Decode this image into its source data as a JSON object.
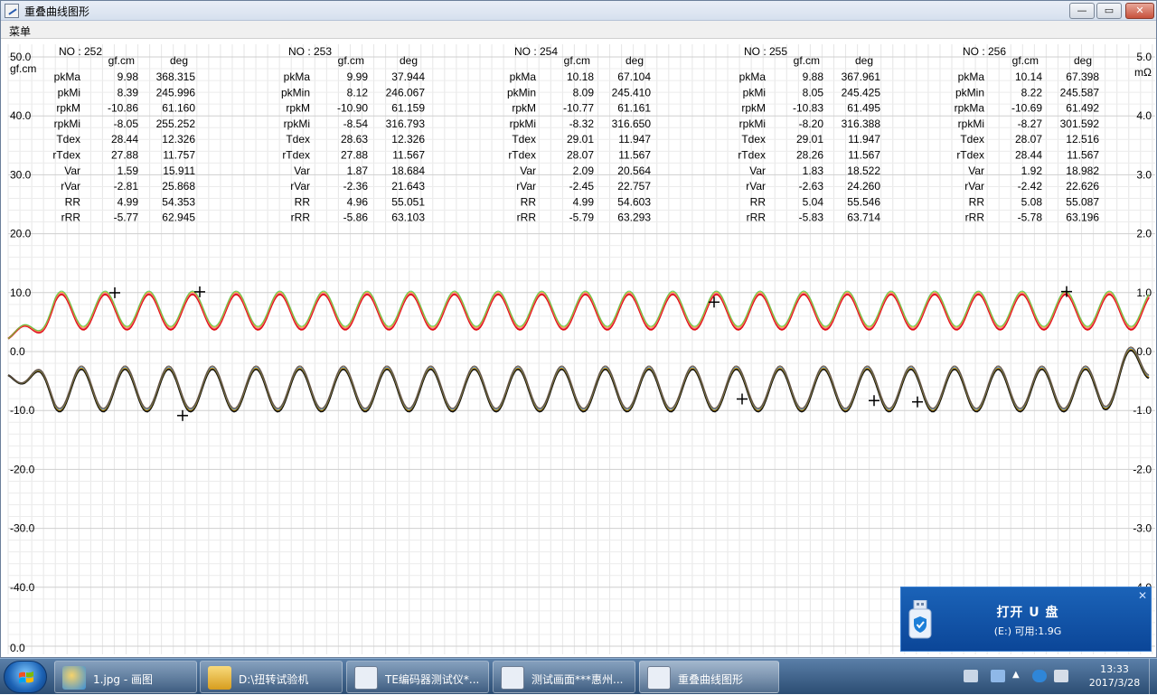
{
  "window": {
    "title": "重叠曲线图形",
    "menu": "菜单",
    "buttons": {
      "minimize": "—",
      "maximize": "▭",
      "close": "✕"
    }
  },
  "chart_data": {
    "type": "line",
    "title": "",
    "left_axis": {
      "unit": "gf.cm",
      "ticks": [
        "50.0",
        "40.0",
        "30.0",
        "20.0",
        "10.0",
        "0.0",
        "-10.0",
        "-20.0",
        "-30.0",
        "-40.0",
        "0.0"
      ],
      "ylim": [
        -50,
        50
      ]
    },
    "right_axis": {
      "unit": "mΩ",
      "ticks": [
        "5.0",
        "4.0",
        "3.0",
        "2.0",
        "1.0",
        "0.0",
        "-1.0",
        "-2.0",
        "-3.0",
        "-4.0"
      ],
      "ylim": [
        -5,
        5
      ]
    },
    "grid": true,
    "series": [
      {
        "color": "#e01010",
        "baseline": 7.0,
        "amplitude": 3.0,
        "period_deg": 15.9
      },
      {
        "color": "#111111",
        "baseline": -6.3,
        "amplitude": 3.6,
        "period_deg": 15.9
      }
    ],
    "measurements": [
      {
        "no": "NO : 252",
        "row_labels": [
          "pkMa",
          "pkMi",
          "rpkM",
          "rpkMi",
          "Tdex",
          "rTdex",
          "Var",
          "rVar",
          "RR",
          "rRR"
        ],
        "gfcm": [
          "9.98",
          "8.39",
          "-10.86",
          "-8.05",
          "28.44",
          "27.88",
          "1.59",
          "-2.81",
          "4.99",
          "-5.77"
        ],
        "deg": [
          "368.315",
          "245.996",
          "61.160",
          "255.252",
          "12.326",
          "11.757",
          "15.911",
          "25.868",
          "54.353",
          "62.945"
        ]
      },
      {
        "no": "NO : 253",
        "row_labels": [
          "pkMa",
          "pkMin",
          "rpkM",
          "rpkMi",
          "Tdex",
          "rTdex",
          "Var",
          "rVar",
          "RR",
          "rRR"
        ],
        "gfcm": [
          "9.99",
          "8.12",
          "-10.90",
          "-8.54",
          "28.63",
          "27.88",
          "1.87",
          "-2.36",
          "4.96",
          "-5.86"
        ],
        "deg": [
          "37.944",
          "246.067",
          "61.159",
          "316.793",
          "12.326",
          "11.567",
          "18.684",
          "21.643",
          "55.051",
          "63.103"
        ]
      },
      {
        "no": "NO : 254",
        "row_labels": [
          "pkMa",
          "pkMin",
          "rpkM",
          "rpkMi",
          "Tdex",
          "rTdex",
          "Var",
          "rVar",
          "RR",
          "rRR"
        ],
        "gfcm": [
          "10.18",
          "8.09",
          "-10.77",
          "-8.32",
          "29.01",
          "28.07",
          "2.09",
          "-2.45",
          "4.99",
          "-5.79"
        ],
        "deg": [
          "67.104",
          "245.410",
          "61.161",
          "316.650",
          "11.947",
          "11.567",
          "20.564",
          "22.757",
          "54.603",
          "63.293"
        ]
      },
      {
        "no": "NO : 255",
        "row_labels": [
          "pkMa",
          "pkMi",
          "rpkM",
          "rpkMi",
          "Tdex",
          "rTdex",
          "Var",
          "rVar",
          "RR",
          "rRR"
        ],
        "gfcm": [
          "9.88",
          "8.05",
          "-10.83",
          "-8.20",
          "29.01",
          "28.26",
          "1.83",
          "-2.63",
          "5.04",
          "-5.83"
        ],
        "deg": [
          "367.961",
          "245.425",
          "61.495",
          "316.388",
          "11.947",
          "11.567",
          "18.522",
          "24.260",
          "55.546",
          "63.714"
        ]
      },
      {
        "no": "NO : 256",
        "row_labels": [
          "pkMa",
          "pkMin",
          "rpkMa",
          "rpkMi",
          "Tdex",
          "rTdex",
          "Var",
          "rVar",
          "RR",
          "rRR"
        ],
        "gfcm": [
          "10.14",
          "8.22",
          "-10.69",
          "-8.27",
          "28.07",
          "28.44",
          "1.92",
          "-2.42",
          "5.08",
          "-5.78"
        ],
        "deg": [
          "67.398",
          "245.587",
          "61.492",
          "301.592",
          "12.516",
          "11.567",
          "18.982",
          "22.626",
          "55.087",
          "63.196"
        ]
      }
    ],
    "col_headers": [
      "gf.cm",
      "deg"
    ]
  },
  "notification": {
    "title": "打开 U 盘",
    "info": "(E:)  可用:1.9G",
    "close": "✕"
  },
  "taskbar": {
    "tasks": [
      {
        "label": "1.jpg - 画图",
        "color": "#3a8fd8"
      },
      {
        "label": "D:\\扭转试验机",
        "color": "#e7b33a"
      },
      {
        "label": "TE编码器测试仪*...",
        "color": "#6a8ec8"
      },
      {
        "label": "测试画面***惠州...",
        "color": "#6a8ec8"
      },
      {
        "label": "重叠曲线图形",
        "color": "#6a8ec8"
      }
    ],
    "time": "13:33",
    "date": "2017/3/28"
  }
}
